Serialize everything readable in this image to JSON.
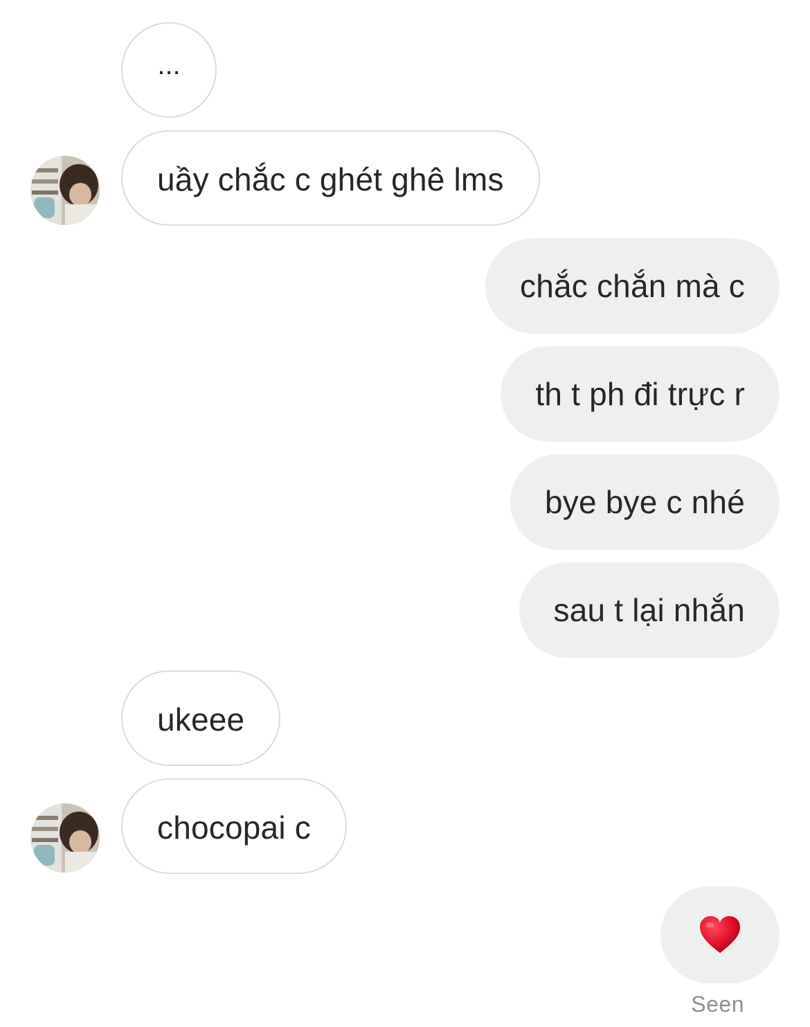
{
  "thread": {
    "typing_text": "...",
    "messages": [
      {
        "side": "incoming",
        "text": "uầy chắc c ghét ghê lms",
        "avatar": true
      },
      {
        "side": "outgoing",
        "text": "chắc chắn mà c"
      },
      {
        "side": "outgoing",
        "text": "th t ph đi trực r"
      },
      {
        "side": "outgoing",
        "text": "bye bye c nhé"
      },
      {
        "side": "outgoing",
        "text": "sau t lại nhắn"
      },
      {
        "side": "incoming",
        "text": "ukeee"
      },
      {
        "side": "incoming",
        "text": "chocopai c",
        "avatar": true
      }
    ],
    "reaction": {
      "icon": "heart-icon",
      "color": "#e0102a"
    },
    "seen_label": "Seen"
  },
  "colors": {
    "incoming_border": "#dbdbdb",
    "outgoing_bg": "#efefef",
    "text": "#262626",
    "seen": "#8e8e8e"
  }
}
